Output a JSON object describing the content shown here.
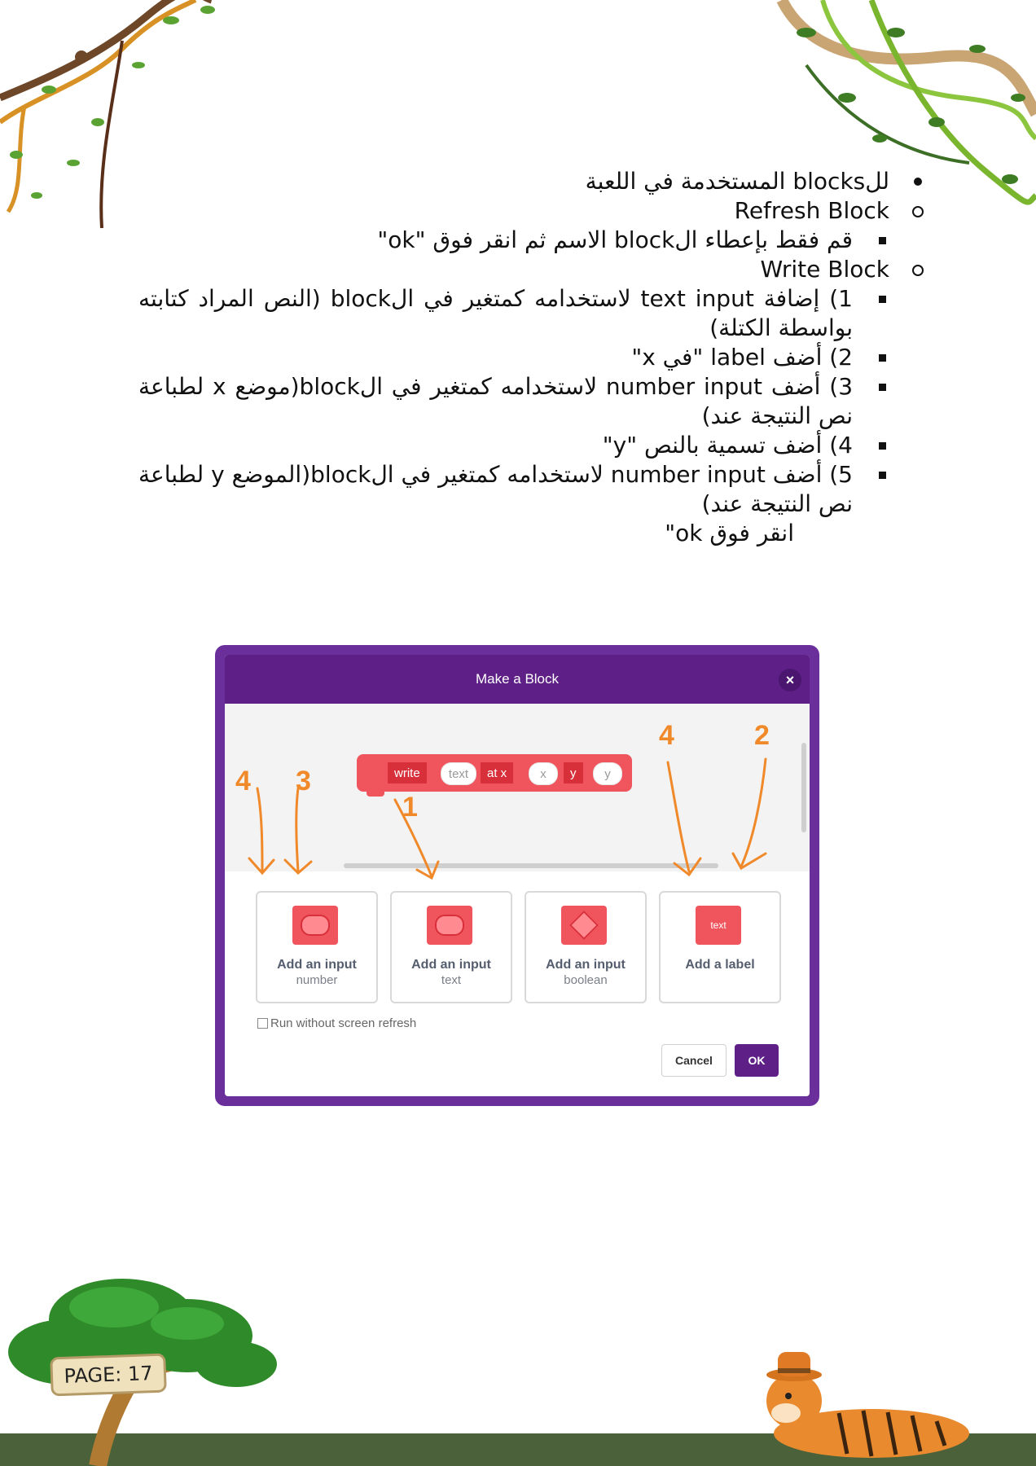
{
  "content": {
    "line1": "للblocks المستخدمة في اللعبة",
    "line2": "Refresh Block",
    "line3": "قم فقط بإعطاء الblock الاسم ثم انقر فوق \"ok\"",
    "line4": "Write Block",
    "item1": "1) إضافة text input لاستخدامه كمتغير في الblock (النص المراد كتابته بواسطة الكتلة)",
    "item2": "2) أضف label \"في x\"",
    "item3": "3) أضف number input لاستخدامه كمتغير في الblock(موضع x لطباعة نص النتيجة عند)",
    "item4": "4) أضف تسمية بالنص \"y\"",
    "item5": "5) أضف number input لاستخدامه كمتغير في الblock(الموضع y لطباعة نص النتيجة عند)",
    "line_end": "انقر فوق ok\""
  },
  "dialog": {
    "title": "Make a Block",
    "close": "×",
    "block_parts": {
      "write": "write",
      "text": "text",
      "at_x": "at x",
      "x": "x",
      "y_label": "y",
      "y_input": "y"
    },
    "cards": [
      {
        "title": "Add an input",
        "subtitle": "number"
      },
      {
        "title": "Add an input",
        "subtitle": "text"
      },
      {
        "title": "Add an input",
        "subtitle": "boolean"
      },
      {
        "title": "Add a label",
        "icon_text": "text"
      }
    ],
    "run_option": "Run without screen refresh",
    "cancel": "Cancel",
    "ok": "OK"
  },
  "annotations": {
    "a4_left": "4",
    "a3": "3",
    "a1": "1",
    "a4_right": "4",
    "a2": "2"
  },
  "footer": {
    "page": "PAGE: 17"
  }
}
